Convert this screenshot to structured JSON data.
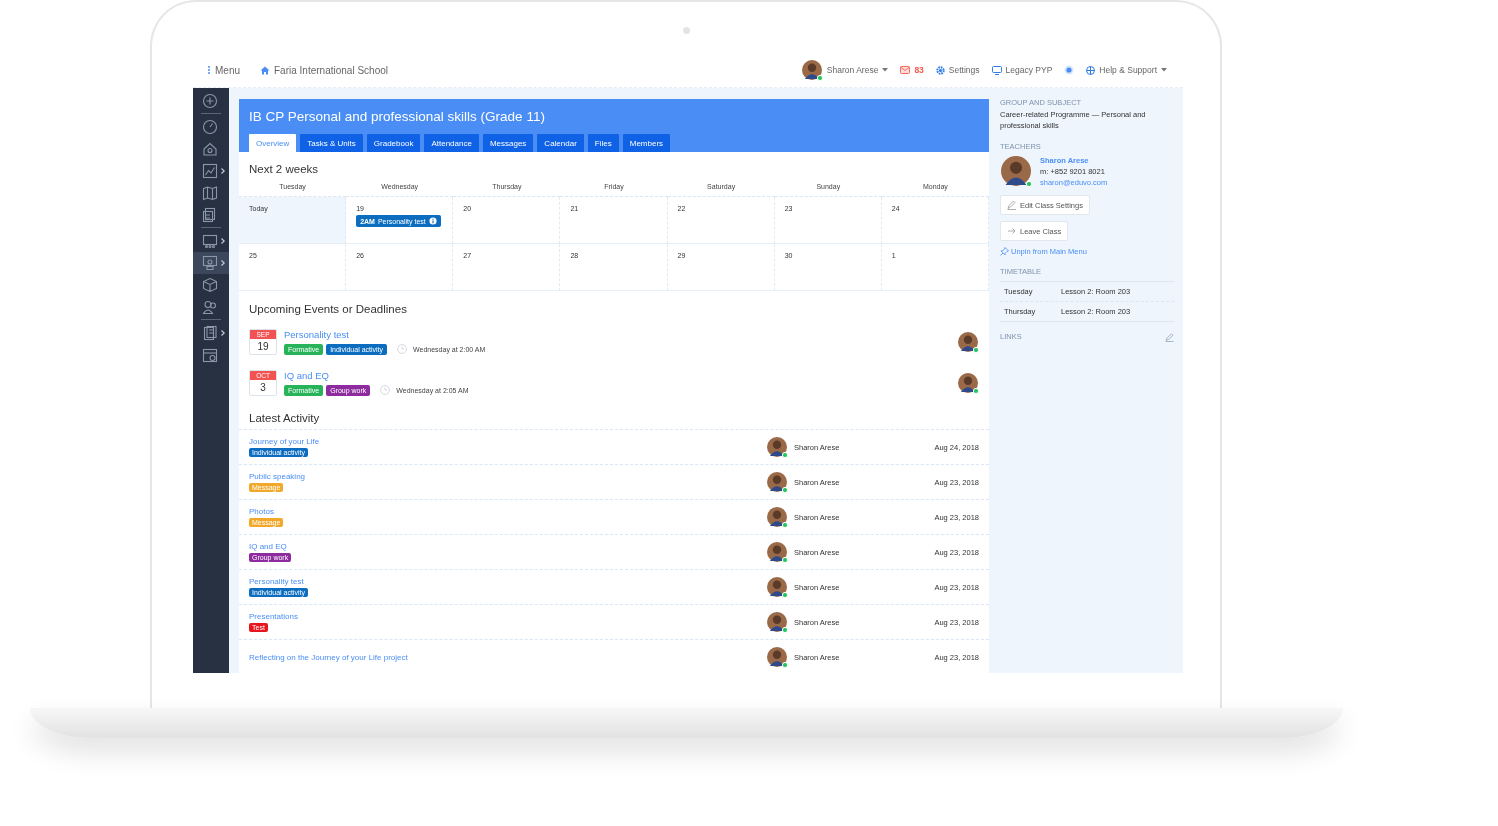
{
  "topbar": {
    "menu": "Menu",
    "school": "Faria International School",
    "user": "Sharon Arese",
    "mail_count": "83",
    "settings": "Settings",
    "legacy": "Legacy PYP",
    "help": "Help & Support"
  },
  "sidebar": {
    "groups": [
      [
        {
          "selected": false,
          "submenu": false
        }
      ],
      [
        {
          "selected": false,
          "submenu": false
        },
        {
          "selected": false,
          "submenu": false
        },
        {
          "selected": false,
          "submenu": true
        },
        {
          "selected": false,
          "submenu": false
        },
        {
          "selected": false,
          "submenu": false
        }
      ],
      [
        {
          "selected": false,
          "submenu": true
        },
        {
          "selected": true,
          "submenu": true
        },
        {
          "selected": false,
          "submenu": false
        },
        {
          "selected": false,
          "submenu": false
        }
      ],
      [
        {
          "selected": false,
          "submenu": true
        },
        {
          "selected": false,
          "submenu": false
        }
      ]
    ]
  },
  "header": {
    "title": "IB CP Personal and professional skills (Grade 11)",
    "tabs": [
      {
        "label": "Overview",
        "selected": true
      },
      {
        "label": "Tasks & Units",
        "selected": false
      },
      {
        "label": "Gradebook",
        "selected": false
      },
      {
        "label": "Attendance",
        "selected": false
      },
      {
        "label": "Messages",
        "selected": false
      },
      {
        "label": "Calendar",
        "selected": false
      },
      {
        "label": "Files",
        "selected": false
      },
      {
        "label": "Members",
        "selected": false
      }
    ]
  },
  "calendar": {
    "title": "Next 2 weeks",
    "weekdays": [
      "Tuesday",
      "Wednesday",
      "Thursday",
      "Friday",
      "Saturday",
      "Sunday",
      "Monday"
    ],
    "weeks": [
      [
        {
          "label": "Today",
          "today": true
        },
        {
          "label": "19",
          "today": false,
          "events": [
            {
              "time": "2AM",
              "title": "Personality test"
            }
          ]
        },
        {
          "label": "20",
          "today": false
        },
        {
          "label": "21",
          "today": false
        },
        {
          "label": "22",
          "today": false
        },
        {
          "label": "23",
          "today": false
        },
        {
          "label": "24",
          "today": false
        }
      ],
      [
        {
          "label": "25",
          "today": false
        },
        {
          "label": "26",
          "today": false
        },
        {
          "label": "27",
          "today": false
        },
        {
          "label": "28",
          "today": false
        },
        {
          "label": "29",
          "today": false
        },
        {
          "label": "30",
          "today": false
        },
        {
          "label": "1",
          "today": false
        }
      ]
    ]
  },
  "upcoming": {
    "title": "Upcoming Events or Deadlines",
    "events": [
      {
        "month": "SEP",
        "day": "19",
        "title": "Personality test",
        "tags": [
          {
            "label": "Formative",
            "color": "#27b35a"
          },
          {
            "label": "Individual activity",
            "color": "#0b6cc0"
          }
        ],
        "time": "Wednesday at 2:00 AM"
      },
      {
        "month": "OCT",
        "day": "3",
        "title": "IQ and EQ",
        "tags": [
          {
            "label": "Formative",
            "color": "#27b35a"
          },
          {
            "label": "Group work",
            "color": "#8e2b9e"
          }
        ],
        "time": "Wednesday at 2:05 AM"
      }
    ]
  },
  "activity": {
    "title": "Latest Activity",
    "rows": [
      {
        "title": "Journey of your Life",
        "tag": {
          "label": "Individual activity",
          "color": "#0b6cc0"
        },
        "person": "Sharon Arese",
        "date": "Aug 24, 2018"
      },
      {
        "title": "Public speaking",
        "tag": {
          "label": "Message",
          "color": "#f2a82a"
        },
        "person": "Sharon Arese",
        "date": "Aug 23, 2018"
      },
      {
        "title": "Photos",
        "tag": {
          "label": "Message",
          "color": "#f2a82a"
        },
        "person": "Sharon Arese",
        "date": "Aug 23, 2018"
      },
      {
        "title": "IQ and EQ",
        "tag": {
          "label": "Group work",
          "color": "#8e2b9e"
        },
        "person": "Sharon Arese",
        "date": "Aug 23, 2018"
      },
      {
        "title": "Personality test",
        "tag": {
          "label": "Individual activity",
          "color": "#0b6cc0"
        },
        "person": "Sharon Arese",
        "date": "Aug 23, 2018"
      },
      {
        "title": "Presentations",
        "tag": {
          "label": "Test",
          "color": "#e8161c"
        },
        "person": "Sharon Arese",
        "date": "Aug 23, 2018"
      },
      {
        "title": "Reflecting on the Journey of your Life project",
        "person": "Sharon Arese",
        "date": "Aug 23, 2018"
      }
    ]
  },
  "panel": {
    "group_heading": "GROUP AND SUBJECT",
    "group_text": "Career-related Programme — Personal and professional skills",
    "teachers_heading": "TEACHERS",
    "teacher": {
      "name": "Sharon Arese",
      "phone": "m: +852 9201 8021",
      "email": "sharon@eduvo.com"
    },
    "buttons": [
      "Edit Class Settings",
      "Leave Class"
    ],
    "unpin": "Unpin from Main Menu",
    "timetable_heading": "TIMETABLE",
    "timetable": [
      {
        "day": "Tuesday",
        "lesson": "Lesson 2: Room 203"
      },
      {
        "day": "Thursday",
        "lesson": "Lesson 2: Room 203"
      }
    ],
    "links_heading": "LINKS"
  }
}
